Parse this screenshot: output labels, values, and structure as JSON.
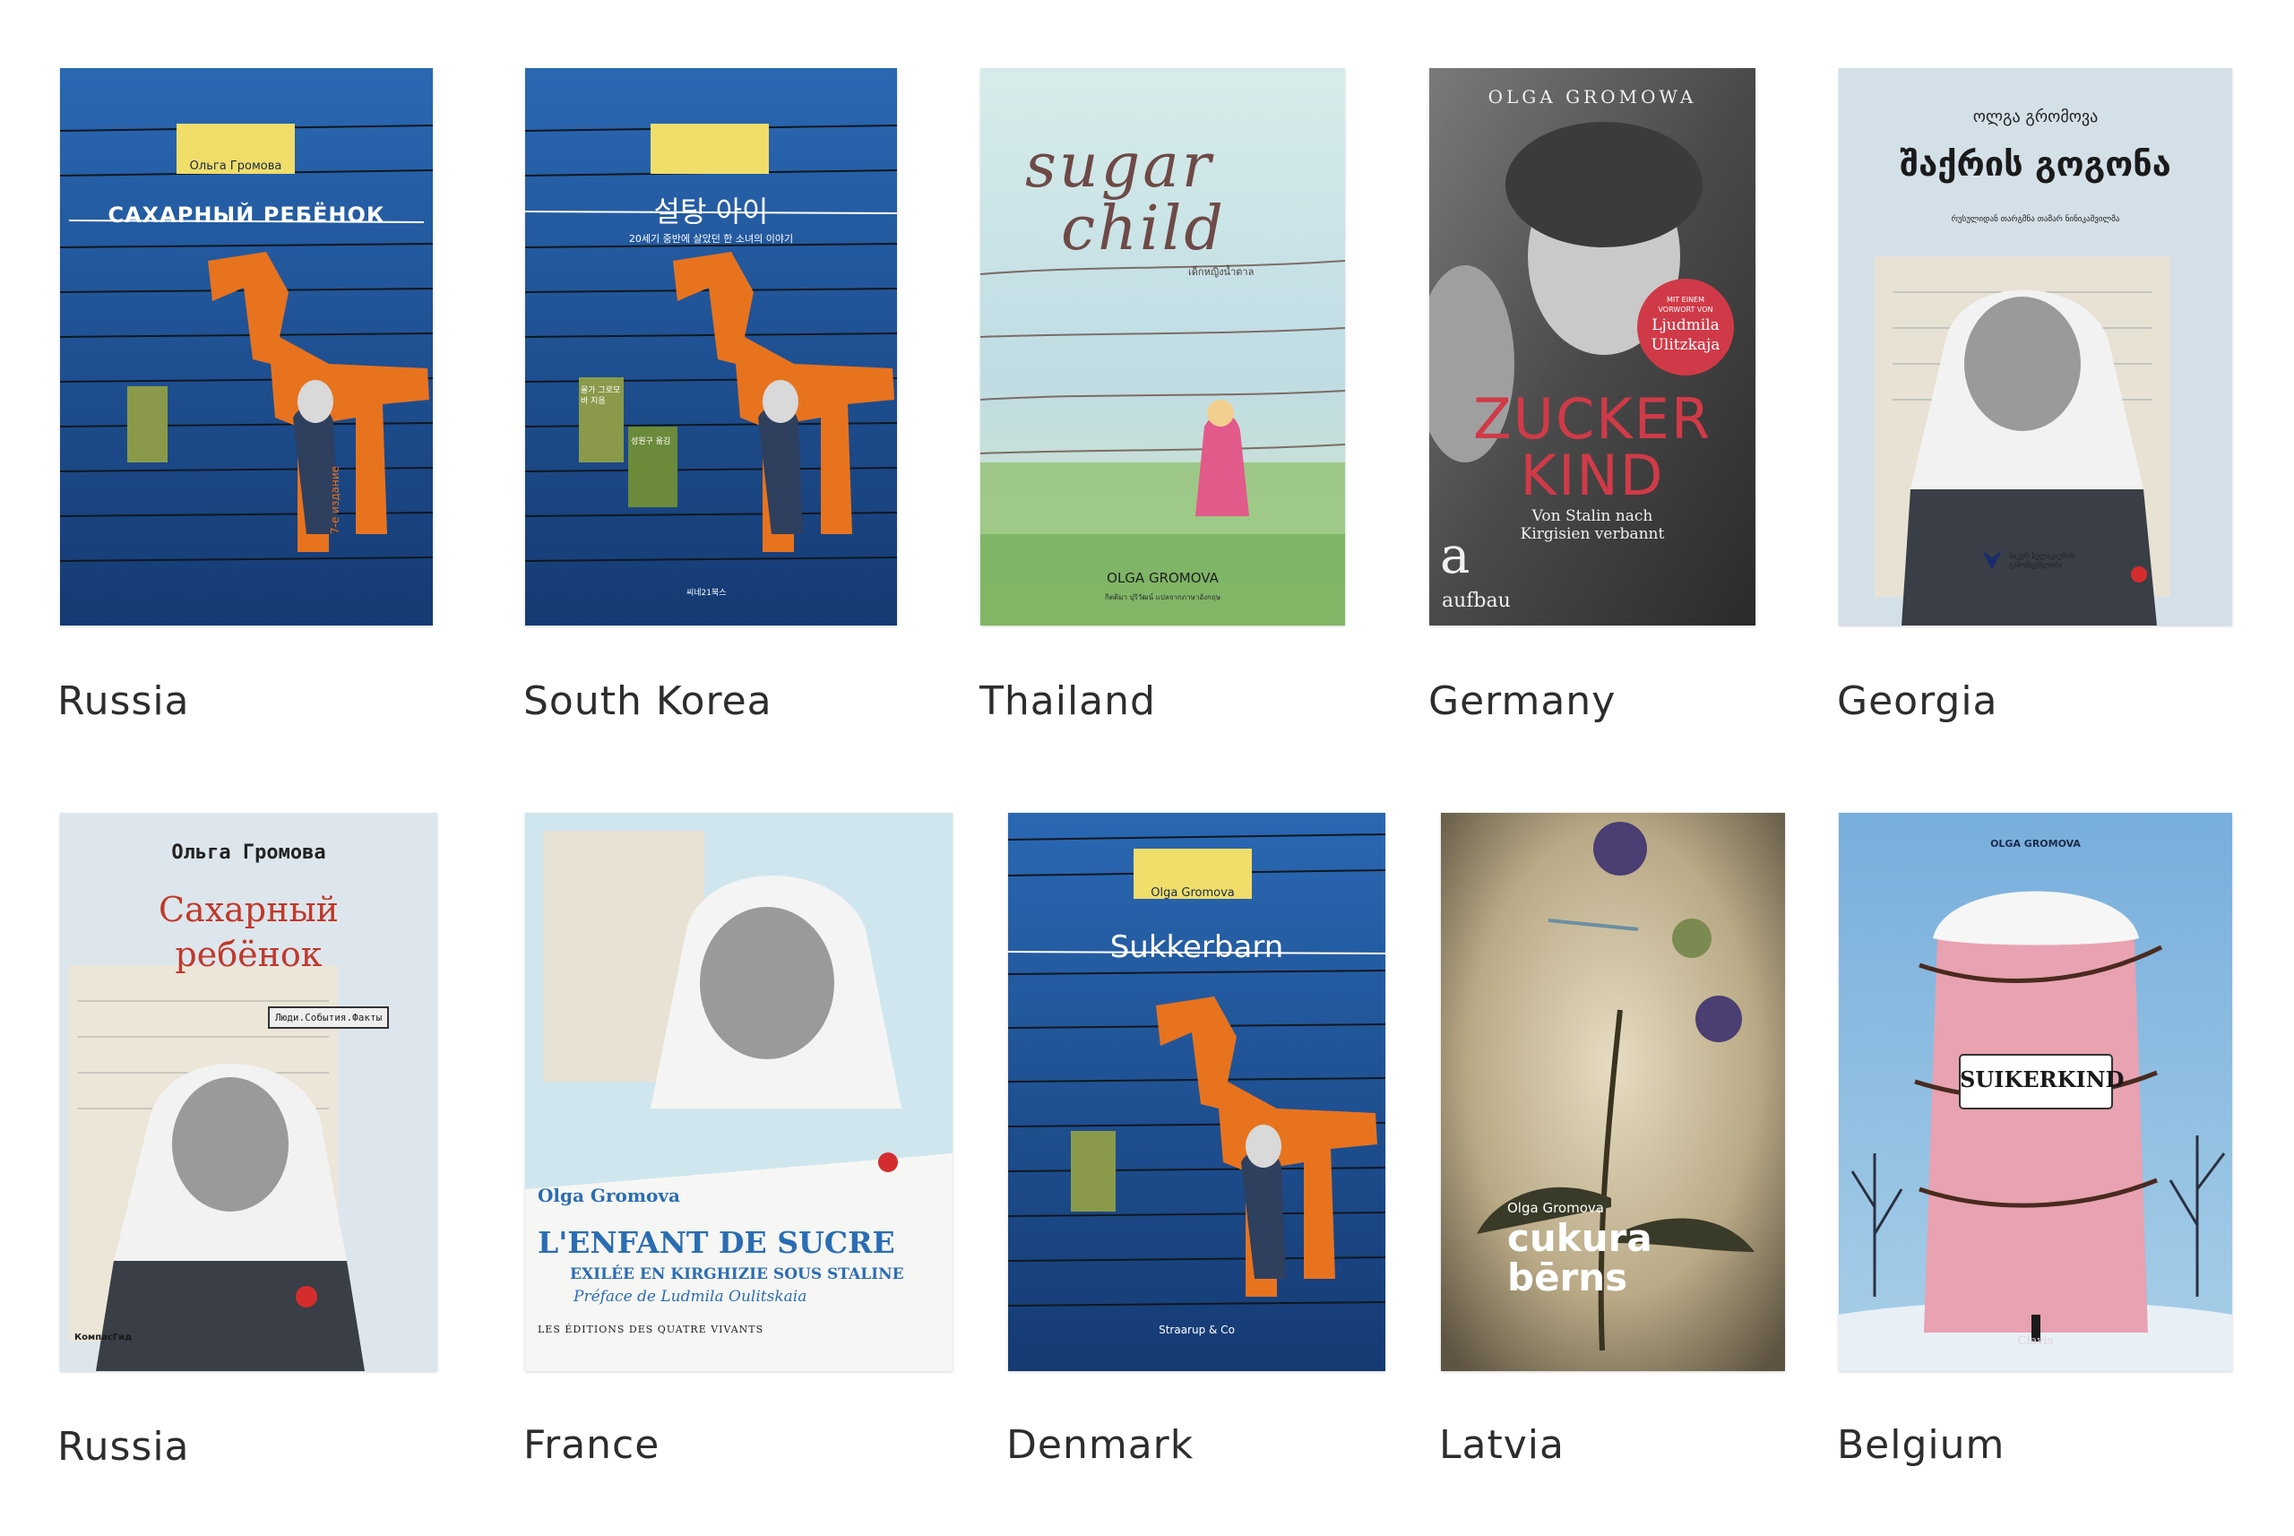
{
  "editions": [
    {
      "country": "Russia",
      "cover": {
        "author": "Ольга Громова",
        "title": "САХАРНЫЙ РЕБЁНОК",
        "edition": "7-е издание"
      }
    },
    {
      "country": "South Korea",
      "cover": {
        "title": "설탕 아이",
        "subtitle": "20세기 중반에 살았던 한 소녀의 이야기",
        "credits": "올가 그로모바 지음",
        "translator": "성원구 옮김",
        "publisher": "씨네21북스"
      }
    },
    {
      "country": "Thailand",
      "cover": {
        "title_line1": "sugar",
        "title_line2": "child",
        "subtitle": "เด็กหญิงน้ำตาล",
        "author": "OLGA GROMOVA",
        "credit": "กิตติมา ปุริวัฒน์ แปลจากภาษาอังกฤษ"
      }
    },
    {
      "country": "Germany",
      "cover": {
        "author": "OLGA GROMOWA",
        "badge_line1": "MIT EINEM",
        "badge_line2": "VORWORT VON",
        "badge_name1": "Ljudmila",
        "badge_name2": "Ulitzkaja",
        "title_line1": "ZUCKER",
        "title_line2": "KIND",
        "subtitle_line1": "Von Stalin nach",
        "subtitle_line2": "Kirgisien verbannt",
        "publisher": "aufbau"
      }
    },
    {
      "country": "Georgia",
      "cover": {
        "author": "ოლგა გრომოვა",
        "title": "შაქრის გოგონა",
        "subtitle": "რუსულიდან თარგმნა თამარ ნინიკაშვილმა",
        "publisher": "ბაკურ სულაკაურის გამომცემლობა"
      }
    },
    {
      "country": "Russia",
      "cover": {
        "author": "Ольга Громова",
        "title_line1": "Сахарный",
        "title_line2": "ребёнок",
        "series": "Люди.События.Факты",
        "publisher": "КомпасГид"
      }
    },
    {
      "country": "France",
      "cover": {
        "author": "Olga Gromova",
        "title": "L'ENFANT DE SUCRE",
        "subtitle": "EXILÉE EN KIRGHIZIE SOUS STALINE",
        "preface": "Préface de Ludmila Oulitskaia",
        "publisher": "LES ÉDITIONS DES QUATRE VIVANTS"
      }
    },
    {
      "country": "Denmark",
      "cover": {
        "author": "Olga Gromova",
        "title": "Sukkerbarn",
        "publisher": "Straarup & Co"
      }
    },
    {
      "country": "Latvia",
      "cover": {
        "author": "Olga Gromova",
        "title_line1": "cukura",
        "title_line2": "bērns"
      }
    },
    {
      "country": "Belgium",
      "cover": {
        "author": "OLGA GROMOVA",
        "title": "SUIKERKIND",
        "publisher": "Clavis"
      }
    }
  ],
  "colors": {
    "label": "#2d2d2d",
    "blue_cover": "#1f4f93",
    "horse_orange": "#e7731f",
    "german_red": "#d03a48",
    "french_blue": "#2b6db3",
    "belgium_pink": "#e8a2b1"
  }
}
